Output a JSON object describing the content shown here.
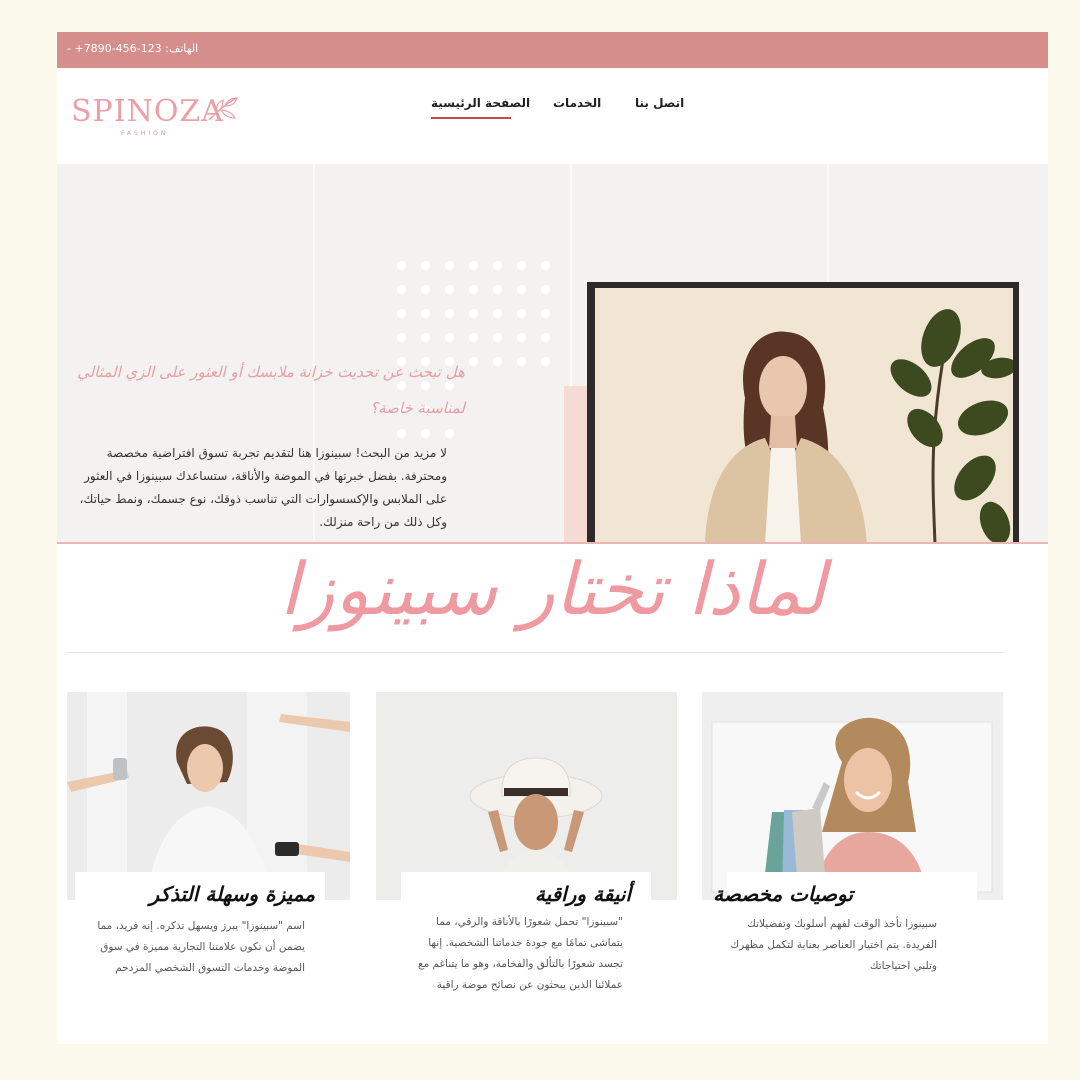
{
  "topbar": {
    "phone": "الهاتف: 123-456-7890+ -"
  },
  "header": {
    "logo_word": "SPINOZA",
    "logo_sub": "FASHION",
    "nav": {
      "home": "الصفحة الرئيسية",
      "services": "الخدمات",
      "contact": "اتصل بنا"
    }
  },
  "hero": {
    "title": "هل تبحث عن تحديث خزانة ملابسك أو العثور على الزي المثالي لمناسبة خاصة؟",
    "body": "لا مزيد من البحث! سبينوزا هنا لتقديم تجربة تسوق افتراضية مخصصة ومحترفة. بفضل خبرتها في الموضة والأناقة، ستساعدك سبينوزا في العثور على الملابس والإكسسوارات التي تناسب ذوقك، نوع جسمك، ونمط حياتك، وكل ذلك من راحة منزلك."
  },
  "why": {
    "title": "لماذا تختار سبينوزا"
  },
  "cards": [
    {
      "title": "توصيات مخصصة",
      "body": "سبينوزا تأخذ الوقت لفهم أسلوبك وتفضيلاتك الفريدة. يتم اختيار العناصر بعناية لتكمل مظهرك وتلبي احتياجاتك"
    },
    {
      "title": "أنيقة وراقية",
      "body": "\"سبينوزا\" تحمل شعورًا بالأناقة والرقي، مما يتماشى تمامًا مع جودة خدماتنا الشخصية. إنها تجسد شعورًا بالتألق والفخامة، وهو ما يتناغم مع عملائنا الذين يبحثون عن نصائح موضة راقية"
    },
    {
      "title": "مميزة وسهلة التذكر",
      "body": "اسم \"سبينوزا\" يبرز ويسهل تذكره. إنه فريد، مما يضمن أن تكون علامتنا التجارية مميزة في سوق الموضة وخدمات التسوق الشخصي المزدحم"
    }
  ],
  "colors": {
    "topbar": "#d58e8c",
    "accent_pink": "#ee9aa0",
    "nav_underline": "#c54a4a",
    "page_bg": "#fbf8ec"
  }
}
